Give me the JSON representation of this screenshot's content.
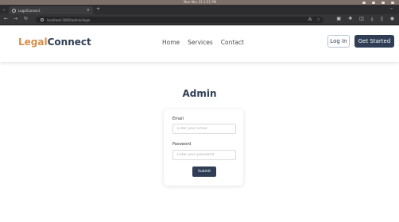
{
  "os": {
    "clock": "Mon Mar 31  2:51 PM"
  },
  "browser": {
    "tab_title": "LegalConnect",
    "url": "localhost:3000/admin/login"
  },
  "header": {
    "logo_part1": "Legal",
    "logo_part2": "Connect",
    "nav": [
      "Home",
      "Services",
      "Contact"
    ],
    "login_label": "Log In",
    "get_started_label": "Get Started"
  },
  "main": {
    "title": "Admin",
    "email_label": "Email",
    "email_placeholder": "Enter your email",
    "password_label": "Password",
    "password_placeholder": "Enter your password",
    "submit_label": "Submit"
  },
  "colors": {
    "brand_primary": "#2f3e55",
    "brand_accent": "#d68f4a"
  }
}
